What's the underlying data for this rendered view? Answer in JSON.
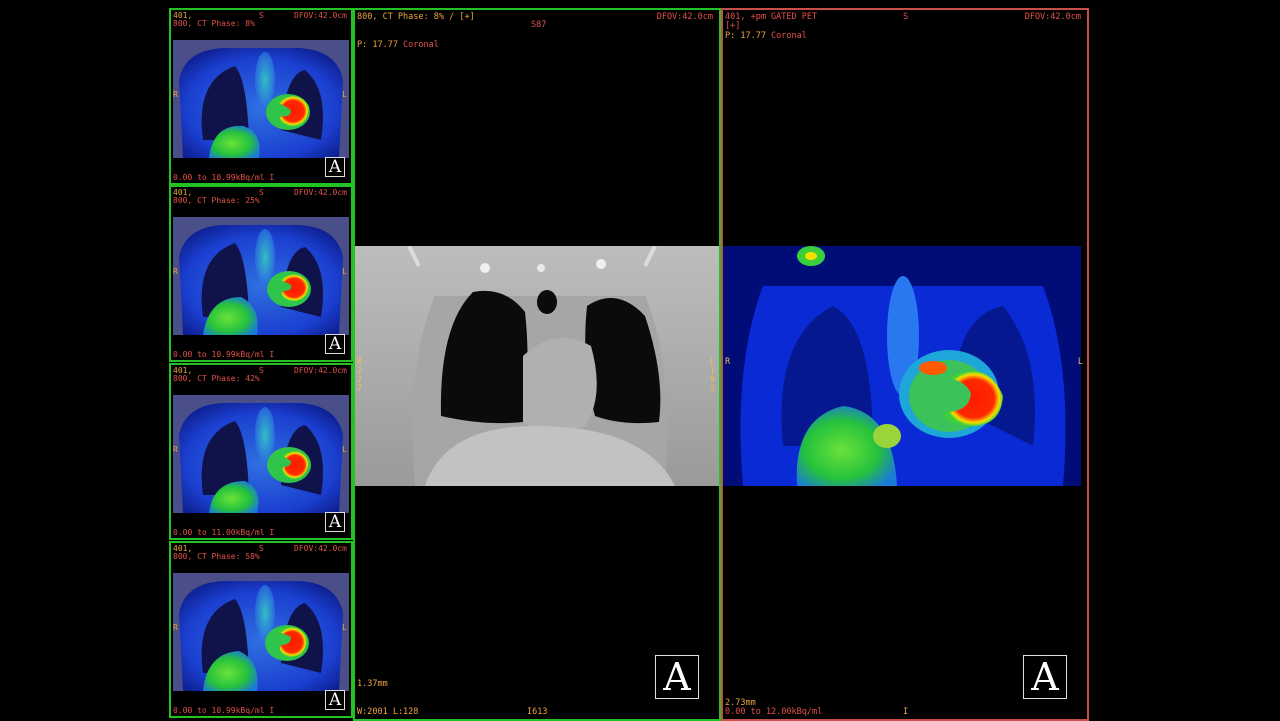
{
  "thumbnails": [
    {
      "series": "401,",
      "phase": "800, CT Phase: 8%",
      "orient_top": "S",
      "dfov": "DFOV:42.0cm",
      "left_marker": "R",
      "right_marker": "L",
      "range": "0.00 to 10.99kBq/ml I",
      "button": "A"
    },
    {
      "series": "401,",
      "phase": "800, CT Phase: 25%",
      "orient_top": "S",
      "dfov": "DFOV:42.0cm",
      "left_marker": "R",
      "right_marker": "L",
      "range": "0.00 to 10.99kBq/ml I",
      "button": "A"
    },
    {
      "series": "401,",
      "phase": "800, CT Phase: 42%",
      "orient_top": "S",
      "dfov": "DFOV:42.0cm",
      "left_marker": "R",
      "right_marker": "L",
      "range": "0.00 to 11.00kBq/ml I",
      "button": "A"
    },
    {
      "series": "401,",
      "phase": "800, CT Phase: 58%",
      "orient_top": "S",
      "dfov": "DFOV:42.0cm",
      "left_marker": "R",
      "right_marker": "L",
      "range": "0.00 to 10.99kBq/ml I",
      "button": "A"
    }
  ],
  "ct_view": {
    "header": "800, CT Phase: 8% / [+]",
    "orient_top": "S87",
    "dfov": "DFOV:42.0cm",
    "position": "P: 17.77",
    "plane": "Coronal",
    "left_marker": "R\n2\n2\n7",
    "right_marker": "L\n1\n9\n3",
    "thickness": "1.37mm",
    "window": "W:2001 L:128",
    "bottom_center": "I613",
    "button": "A"
  },
  "pet_view": {
    "header": "401, +pm GATED PET\n[+]",
    "orient_top": "S",
    "dfov": "DFOV:42.0cm",
    "position": "P: 17.77",
    "plane": "Coronal",
    "left_marker": "R",
    "right_marker": "L",
    "thickness": "2.73mm",
    "range": "0.00 to 12.00kBq/ml",
    "bottom_center": "I",
    "button": "A"
  },
  "colors": {
    "active_border": "#22c322",
    "pet_border": "#c8504a",
    "overlay_text": "#e8a640",
    "overlay_red": "#e4524a"
  }
}
